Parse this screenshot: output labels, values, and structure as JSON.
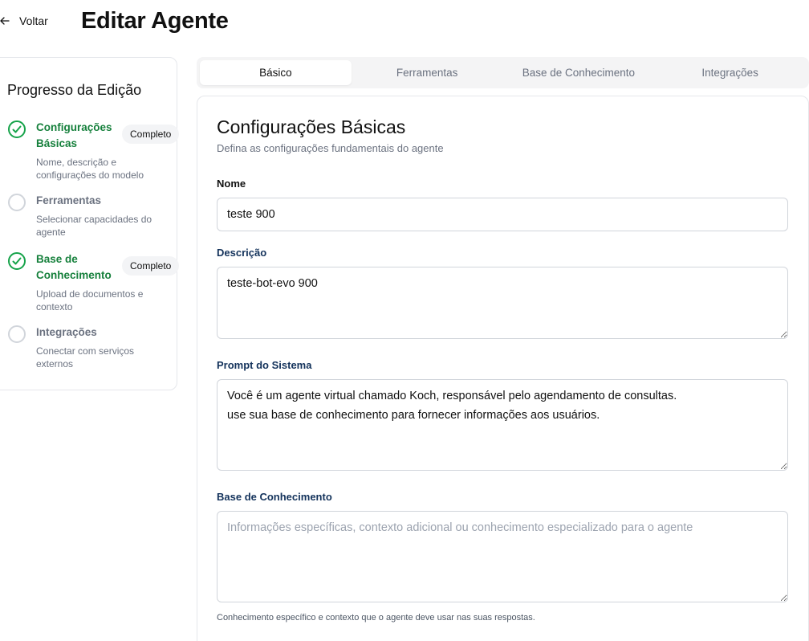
{
  "header": {
    "back_label": "Voltar",
    "title": "Editar Agente"
  },
  "progress": {
    "title": "Progresso da Edição",
    "steps": [
      {
        "name": "Configurações Básicas",
        "desc": "Nome, descrição e configurações do modelo",
        "status": "Completo"
      },
      {
        "name": "Ferramentas",
        "desc": "Selecionar capacidades do agente",
        "status": ""
      },
      {
        "name": "Base de Conhecimento",
        "desc": "Upload de documentos e contexto",
        "status": "Completo"
      },
      {
        "name": "Integrações",
        "desc": "Conectar com serviços externos",
        "status": ""
      }
    ]
  },
  "tabs": [
    {
      "label": "Básico",
      "active": true
    },
    {
      "label": "Ferramentas",
      "active": false
    },
    {
      "label": "Base de Conhecimento",
      "active": false
    },
    {
      "label": "Integrações",
      "active": false
    }
  ],
  "form": {
    "title": "Configurações Básicas",
    "subtitle": "Defina as configurações fundamentais do agente",
    "name_label": "Nome",
    "name_value": "teste 900",
    "desc_label": "Descrição",
    "desc_value": "teste-bot-evo 900",
    "prompt_label": "Prompt do Sistema",
    "prompt_value": "Você é um agente virtual chamado Koch, responsável pelo agendamento de consultas.\nuse sua base de conhecimento para fornecer informações aos usuários.",
    "kb_label": "Base de Conhecimento",
    "kb_placeholder": "Informações específicas, contexto adicional ou conhecimento especializado para o agente",
    "kb_helper": "Conhecimento específico e contexto que o agente deve usar nas suas respostas."
  },
  "colors": {
    "complete_green": "#16a34a",
    "label_blue": "#13325b",
    "muted": "#6b7280"
  }
}
